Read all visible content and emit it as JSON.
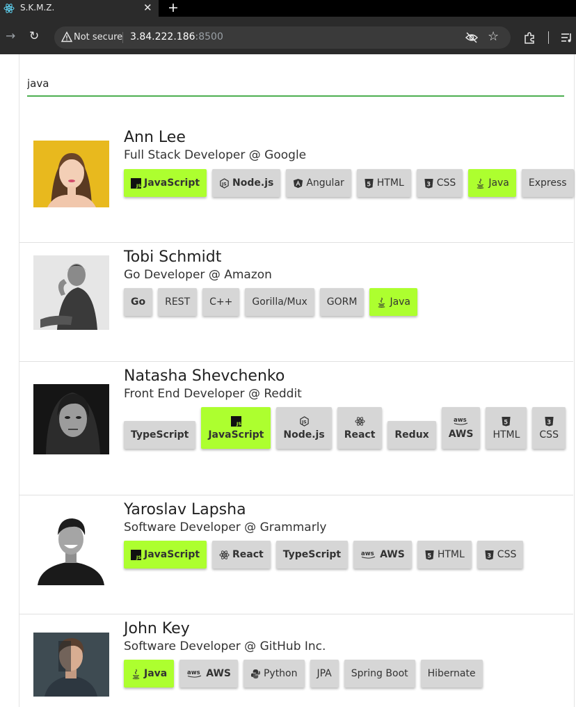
{
  "browser": {
    "tab_title": "S.K.M.Z.",
    "security_label": "Not secure",
    "url_host": "3.84.222.186",
    "url_port": ":8500"
  },
  "search": {
    "value": "java"
  },
  "colors": {
    "highlight": "#adff2f",
    "chip": "#d6d6d6",
    "search_underline": "#4caf50"
  },
  "developers": [
    {
      "name": "Ann Lee",
      "role": "Full Stack Developer @ Google",
      "skills": [
        {
          "label": "JavaScript",
          "icon": "js-icon",
          "highlight": true
        },
        {
          "label": "Node.js",
          "icon": "nodejs-icon",
          "highlight": false
        },
        {
          "label": "Angular",
          "icon": "angular-icon",
          "highlight": false
        },
        {
          "label": "HTML",
          "icon": "html5-icon",
          "highlight": false
        },
        {
          "label": "CSS",
          "icon": "css3-icon",
          "highlight": false
        },
        {
          "label": "Java",
          "icon": "java-icon",
          "highlight": true
        },
        {
          "label": "Express",
          "icon": "",
          "highlight": false
        }
      ]
    },
    {
      "name": "Tobi Schmidt",
      "role": "Go Developer @ Amazon",
      "skills": [
        {
          "label": "Go",
          "icon": "",
          "highlight": false
        },
        {
          "label": "REST",
          "icon": "",
          "highlight": false
        },
        {
          "label": "C++",
          "icon": "",
          "highlight": false
        },
        {
          "label": "Gorilla/Mux",
          "icon": "",
          "highlight": false
        },
        {
          "label": "GORM",
          "icon": "",
          "highlight": false
        },
        {
          "label": "Java",
          "icon": "java-icon",
          "highlight": true
        }
      ]
    },
    {
      "name": "Natasha Shevchenko",
      "role": "Front End Developer @ Reddit",
      "skills": [
        {
          "label": "TypeScript",
          "icon": "",
          "highlight": false
        },
        {
          "label": "JavaScript",
          "icon": "js-icon",
          "highlight": true
        },
        {
          "label": "Node.js",
          "icon": "nodejs-icon",
          "highlight": false
        },
        {
          "label": "React",
          "icon": "react-icon",
          "highlight": false
        },
        {
          "label": "Redux",
          "icon": "",
          "highlight": false
        },
        {
          "label": "AWS",
          "icon": "aws-icon",
          "highlight": false
        },
        {
          "label": "HTML",
          "icon": "html5-icon",
          "highlight": false
        },
        {
          "label": "CSS",
          "icon": "css3-icon",
          "highlight": false
        }
      ]
    },
    {
      "name": "Yaroslav Lapsha",
      "role": "Software Developer @ Grammarly",
      "skills": [
        {
          "label": "JavaScript",
          "icon": "js-icon",
          "highlight": true
        },
        {
          "label": "React",
          "icon": "react-icon",
          "highlight": false
        },
        {
          "label": "TypeScript",
          "icon": "",
          "highlight": false
        },
        {
          "label": "AWS",
          "icon": "aws-icon",
          "highlight": false
        },
        {
          "label": "HTML",
          "icon": "html5-icon",
          "highlight": false
        },
        {
          "label": "CSS",
          "icon": "css3-icon",
          "highlight": false
        }
      ]
    },
    {
      "name": "John Key",
      "role": "Software Developer @ GitHub Inc.",
      "skills": [
        {
          "label": "Java",
          "icon": "java-icon",
          "highlight": true
        },
        {
          "label": "AWS",
          "icon": "aws-icon",
          "highlight": false
        },
        {
          "label": "Python",
          "icon": "python-icon",
          "highlight": false
        },
        {
          "label": "JPA",
          "icon": "",
          "highlight": false
        },
        {
          "label": "Spring Boot",
          "icon": "",
          "highlight": false
        },
        {
          "label": "Hibernate",
          "icon": "",
          "highlight": false
        }
      ]
    }
  ]
}
